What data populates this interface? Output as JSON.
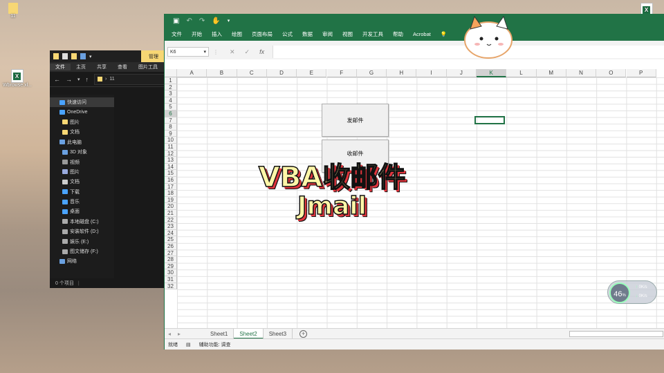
{
  "desktop": {
    "folder_label": "11",
    "excel_file_label": "Wbrowse.xl..."
  },
  "explorer": {
    "manage_tab": "管理",
    "ribbon_tabs": [
      "文件",
      "主页",
      "共享",
      "查看",
      "图片工具"
    ],
    "path": "11",
    "nav_items": [
      {
        "label": "快速访问",
        "icon": "star-icon",
        "indent": 0,
        "selected": true
      },
      {
        "label": "OneDrive",
        "icon": "cloud-icon",
        "indent": 0
      },
      {
        "label": "图片",
        "icon": "folder-icon",
        "indent": 1
      },
      {
        "label": "文档",
        "icon": "folder-icon",
        "indent": 1
      },
      {
        "label": "此电脑",
        "icon": "computer-icon",
        "indent": 0
      },
      {
        "label": "3D 对象",
        "icon": "cube-icon",
        "indent": 1
      },
      {
        "label": "视频",
        "icon": "video-icon",
        "indent": 1
      },
      {
        "label": "图片",
        "icon": "picture-icon",
        "indent": 1
      },
      {
        "label": "文档",
        "icon": "document-icon",
        "indent": 1
      },
      {
        "label": "下载",
        "icon": "download-icon",
        "indent": 1
      },
      {
        "label": "音乐",
        "icon": "music-icon",
        "indent": 1
      },
      {
        "label": "桌面",
        "icon": "desktop-icon",
        "indent": 1
      },
      {
        "label": "本地磁盘 (C:)",
        "icon": "drive-icon",
        "indent": 1
      },
      {
        "label": "安装软件 (D:)",
        "icon": "drive-icon",
        "indent": 1
      },
      {
        "label": "娱乐 (E:)",
        "icon": "drive-icon",
        "indent": 1
      },
      {
        "label": "图文储存 (F:)",
        "icon": "drive-icon",
        "indent": 1
      },
      {
        "label": "网络",
        "icon": "network-icon",
        "indent": 0
      }
    ],
    "status": "0 个项目"
  },
  "excel": {
    "tabs": [
      "文件",
      "开始",
      "插入",
      "绘图",
      "页面布局",
      "公式",
      "数据",
      "审阅",
      "视图",
      "开发工具",
      "帮助",
      "Acrobat"
    ],
    "name_box": "K6",
    "columns": [
      "A",
      "B",
      "C",
      "D",
      "E",
      "F",
      "G",
      "H",
      "I",
      "J",
      "K",
      "L",
      "M",
      "N",
      "O",
      "P"
    ],
    "active_column": "K",
    "rows": [
      "1",
      "2",
      "3",
      "4",
      "5",
      "6",
      "7",
      "8",
      "9",
      "10",
      "11",
      "12",
      "13",
      "14",
      "15",
      "16",
      "17",
      "18",
      "19",
      "20",
      "21",
      "22",
      "23",
      "24",
      "25",
      "26",
      "27",
      "28",
      "29",
      "30",
      "31",
      "32"
    ],
    "active_row": "6",
    "buttons": {
      "send": "发邮件",
      "receive": "收邮件"
    },
    "sheets": [
      "Sheet1",
      "Sheet2",
      "Sheet3"
    ],
    "active_sheet": "Sheet2",
    "status_ready": "就绪",
    "status_accessibility": "辅助功能: 调查"
  },
  "overlay": {
    "title": "VBA收邮件",
    "subtitle": "Jmail"
  },
  "widget": {
    "percent": "46",
    "percent_unit": "%",
    "up_rate": "0K/s",
    "down_rate": "0K/s"
  },
  "colors": {
    "excel_green": "#217346",
    "overlay_text": "#fff6a8",
    "overlay_shadow": "#e0353d"
  }
}
